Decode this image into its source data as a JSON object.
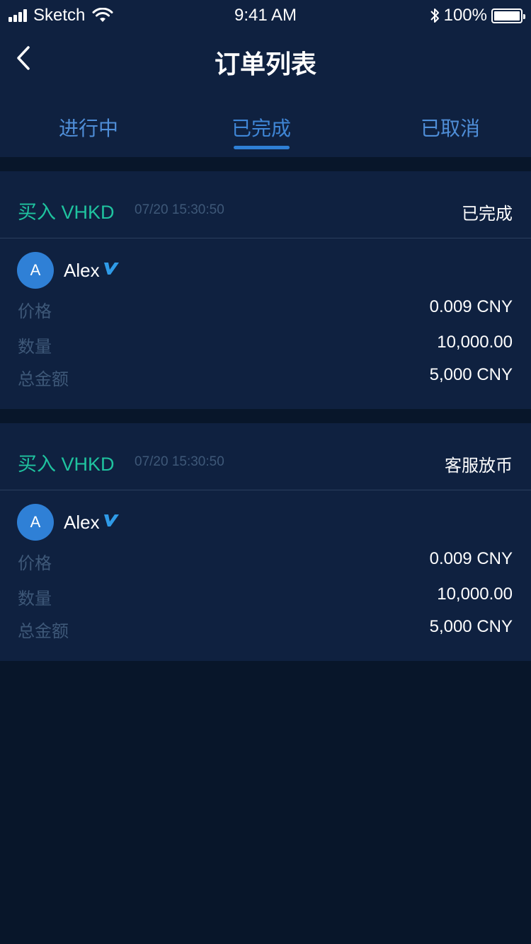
{
  "status_bar": {
    "carrier": "Sketch",
    "time": "9:41 AM",
    "battery": "100%"
  },
  "nav": {
    "title": "订单列表"
  },
  "tabs": [
    {
      "label": "进行中",
      "active": false
    },
    {
      "label": "已完成",
      "active": true
    },
    {
      "label": "已取消",
      "active": false
    }
  ],
  "orders": [
    {
      "type": "买入 VHKD",
      "time": "07/20 15:30:50",
      "status": "已完成",
      "user": {
        "initial": "A",
        "name": "Alex"
      },
      "rows": [
        {
          "label": "价格",
          "value": "0.009 CNY"
        },
        {
          "label": "数量",
          "value": "10,000.00"
        },
        {
          "label": "总金额",
          "value": "5,000 CNY"
        }
      ]
    },
    {
      "type": "买入 VHKD",
      "time": "07/20 15:30:50",
      "status": "客服放币",
      "user": {
        "initial": "A",
        "name": "Alex"
      },
      "rows": [
        {
          "label": "价格",
          "value": "0.009 CNY"
        },
        {
          "label": "数量",
          "value": "10,000.00"
        },
        {
          "label": "总金额",
          "value": "5,000 CNY"
        }
      ]
    }
  ],
  "colors": {
    "background": "#08162a",
    "surface": "#0f2140",
    "accent_blue": "#2f80d6",
    "buy_green": "#1fc39f",
    "muted_text": "#3e5878"
  }
}
